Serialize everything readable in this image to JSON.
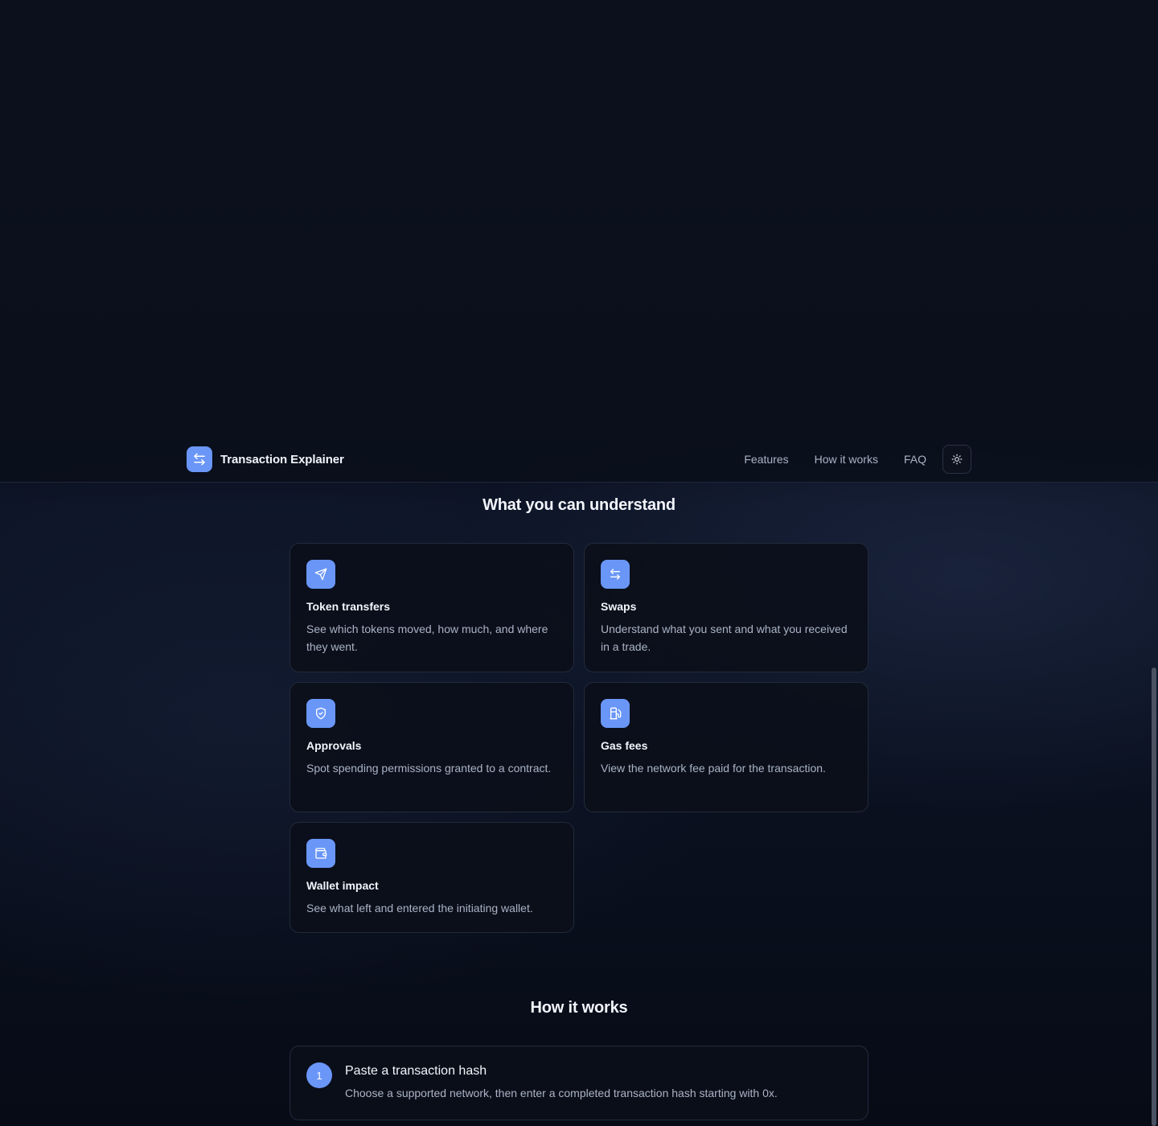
{
  "navbar": {
    "brand_name": "Transaction Explainer",
    "links": [
      "Features",
      "How it works",
      "FAQ"
    ],
    "theme_toggle_icon": "sun-icon"
  },
  "features": {
    "title": "What you can understand",
    "cards": [
      {
        "icon": "send-icon",
        "title": "Token transfers",
        "desc": "See which tokens moved, how much, and where they went."
      },
      {
        "icon": "swap-arrows-icon",
        "title": "Swaps",
        "desc": "Understand what you sent and what you received in a trade."
      },
      {
        "icon": "shield-check-icon",
        "title": "Approvals",
        "desc": "Spot spending permissions granted to a contract."
      },
      {
        "icon": "fuel-icon",
        "title": "Gas fees",
        "desc": "View the network fee paid for the transaction."
      },
      {
        "icon": "wallet-icon",
        "title": "Wallet impact",
        "desc": "See what left and entered the initiating wallet."
      }
    ]
  },
  "how_it_works": {
    "title": "How it works",
    "steps": [
      {
        "number": "1",
        "title": "Paste a transaction hash",
        "desc": "Choose a supported network, then enter a completed transaction hash starting with 0x."
      }
    ]
  },
  "colors": {
    "accent": "#6a96f8",
    "background": "#070b16",
    "card_border": "#222a3b",
    "text_muted": "#aab3c5"
  }
}
